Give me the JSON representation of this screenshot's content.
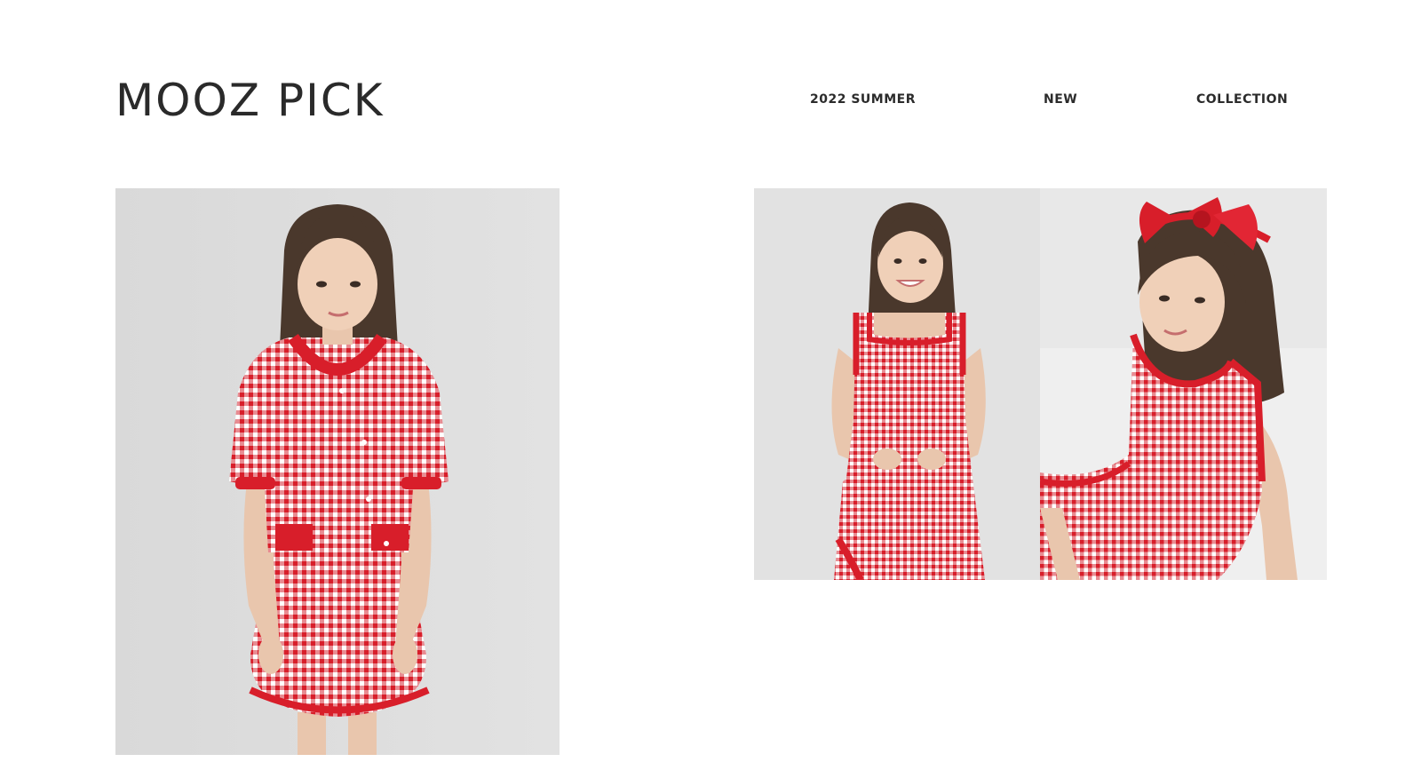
{
  "header": {
    "logo_text": "MOOZ PICK",
    "nav": [
      {
        "label": "2022 SUMMER"
      },
      {
        "label": "NEW"
      },
      {
        "label": "COLLECTION"
      }
    ]
  },
  "gallery": {
    "images": [
      {
        "name": "girl-gingham-cardigan-dress"
      },
      {
        "name": "girl-gingham-sleeveless-dress-smiling"
      },
      {
        "name": "girl-gingham-dress-red-bow-headband"
      }
    ]
  },
  "colors": {
    "gingham_red": "#e0202c",
    "background": "#ffffff",
    "text": "#2b2b2b"
  }
}
